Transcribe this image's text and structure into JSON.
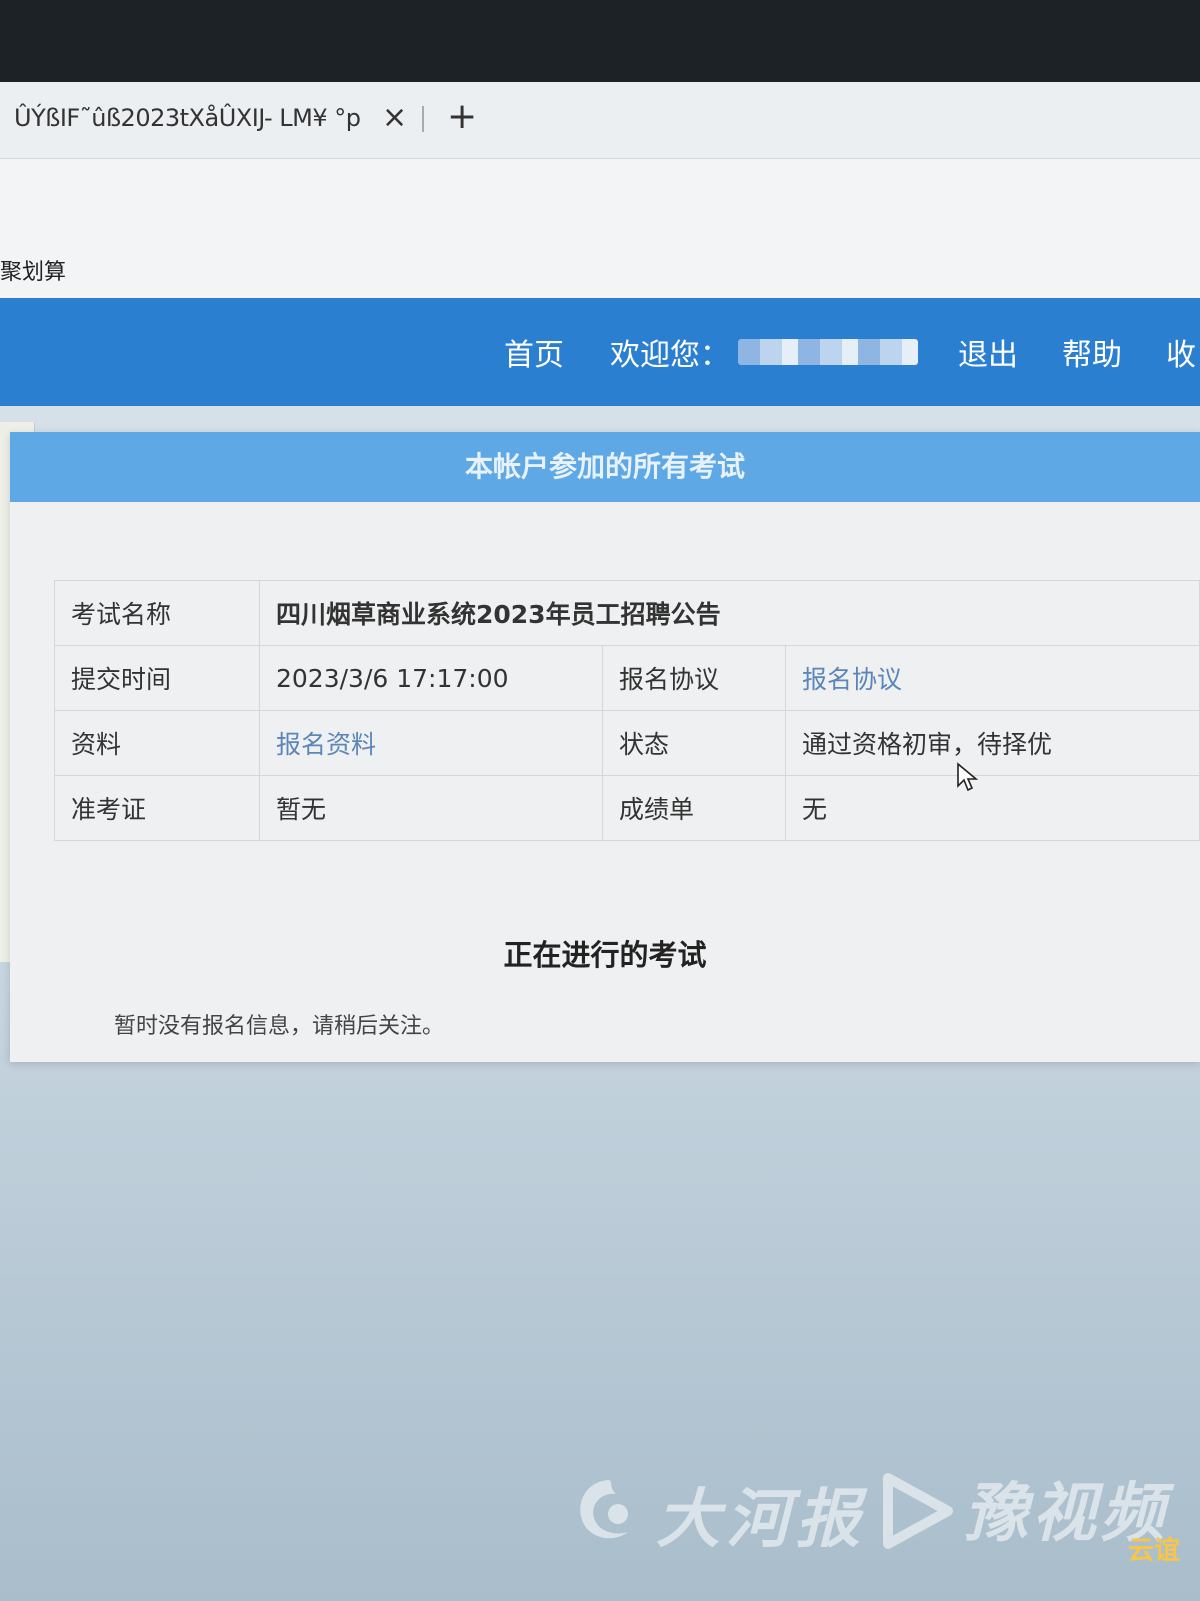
{
  "browser": {
    "tab_title": "ÛÝßIF˜ûß2023tXåÛXIJ- LM¥ °p",
    "close_symbol": "×",
    "new_tab_symbol": "+",
    "bookmark": "聚划算"
  },
  "header": {
    "nav": {
      "home": "首页",
      "welcome": "欢迎您：",
      "logout": "退出",
      "help": "帮助",
      "extra": "收"
    }
  },
  "panel": {
    "title": "本帐户参加的所有考试",
    "exam": {
      "name_label": "考试名称",
      "name": "四川烟草商业系统2023年员工招聘公告",
      "submit_time_label": "提交时间",
      "submit_time": "2023/3/6 17:17:00",
      "agreement_label": "报名协议",
      "agreement_link": "报名协议",
      "materials_label": "资料",
      "materials_link": "报名资料",
      "status_label": "状态",
      "status": "通过资格初审，待择优",
      "ticket_label": "准考证",
      "ticket": "暂无",
      "transcript_label": "成绩单",
      "transcript": "无"
    },
    "ongoing_title": "正在进行的考试",
    "ongoing_notice": "暂时没有报名信息，请稍后关注。"
  },
  "watermark": {
    "brand1": "大河报",
    "brand2": "豫视频",
    "brand3": "云谊"
  },
  "colors": {
    "header_blue": "#2a7fd0",
    "panel_head_blue": "#5ea8e6",
    "link_blue": "#5c86b8",
    "status_red": "#e0505a"
  }
}
